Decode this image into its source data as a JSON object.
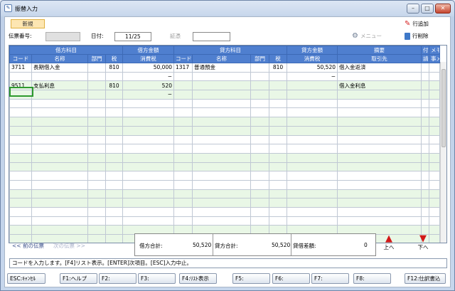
{
  "window": {
    "title": "振替入力",
    "minimize": "–",
    "maximize": "□",
    "close": "✕"
  },
  "toolbar": {
    "new_label": "新規",
    "slip_no_label": "伝票番号:",
    "slip_no_value": "",
    "date_label": "日付:",
    "date_value": "11/25",
    "summary_label": "証憑",
    "summary_value": "",
    "menu_label": "メニュー",
    "add_row_label": "行追加",
    "delete_row_label": "行削除"
  },
  "grid": {
    "group_headers": [
      "借方科目",
      "借方金額",
      "貸方科目",
      "貸方金額",
      "摘要",
      "付",
      "メモ"
    ],
    "sub_headers": [
      "コード",
      "名称",
      "部門",
      "税",
      "消費税",
      "コード",
      "名称",
      "部門",
      "税",
      "消費税",
      "取引先",
      "請",
      "事メモ"
    ],
    "rows": [
      [
        "3711",
        "長期借入金",
        "",
        "810",
        "50,000",
        "1317",
        "普通預金",
        "",
        "810",
        "50,520",
        "借入金返済",
        "",
        ""
      ],
      [
        "",
        "",
        "",
        "",
        "−",
        "",
        "",
        "",
        "",
        "−",
        "",
        "",
        ""
      ],
      [
        "9511",
        "支払利息",
        "",
        "810",
        "520",
        "",
        "",
        "",
        "",
        "",
        "借入金利息",
        "",
        ""
      ],
      [
        "",
        "",
        "",
        "",
        "−",
        "",
        "",
        "",
        "",
        "",
        "",
        "",
        ""
      ],
      [
        "",
        "",
        "",
        "",
        "",
        "",
        "",
        "",
        "",
        "",
        "",
        "",
        ""
      ],
      [
        "",
        "",
        "",
        "",
        "",
        "",
        "",
        "",
        "",
        "",
        "",
        "",
        ""
      ],
      [
        "",
        "",
        "",
        "",
        "",
        "",
        "",
        "",
        "",
        "",
        "",
        "",
        ""
      ],
      [
        "",
        "",
        "",
        "",
        "",
        "",
        "",
        "",
        "",
        "",
        "",
        "",
        ""
      ],
      [
        "",
        "",
        "",
        "",
        "",
        "",
        "",
        "",
        "",
        "",
        "",
        "",
        ""
      ],
      [
        "",
        "",
        "",
        "",
        "",
        "",
        "",
        "",
        "",
        "",
        "",
        "",
        ""
      ],
      [
        "",
        "",
        "",
        "",
        "",
        "",
        "",
        "",
        "",
        "",
        "",
        "",
        ""
      ],
      [
        "",
        "",
        "",
        "",
        "",
        "",
        "",
        "",
        "",
        "",
        "",
        "",
        ""
      ],
      [
        "",
        "",
        "",
        "",
        "",
        "",
        "",
        "",
        "",
        "",
        "",
        "",
        ""
      ],
      [
        "",
        "",
        "",
        "",
        "",
        "",
        "",
        "",
        "",
        "",
        "",
        "",
        ""
      ],
      [
        "",
        "",
        "",
        "",
        "",
        "",
        "",
        "",
        "",
        "",
        "",
        "",
        ""
      ],
      [
        "",
        "",
        "",
        "",
        "",
        "",
        "",
        "",
        "",
        "",
        "",
        "",
        ""
      ],
      [
        "",
        "",
        "",
        "",
        "",
        "",
        "",
        "",
        "",
        "",
        "",
        "",
        ""
      ],
      [
        "",
        "",
        "",
        "",
        "",
        "",
        "",
        "",
        "",
        "",
        "",
        "",
        ""
      ],
      [
        "",
        "",
        "",
        "",
        "",
        "",
        "",
        "",
        "",
        "",
        "",
        "",
        ""
      ],
      [
        "",
        "",
        "",
        "",
        "",
        "",
        "",
        "",
        "",
        "",
        "",
        "",
        ""
      ]
    ]
  },
  "nav": {
    "prev": "<< 前の伝票",
    "next": "次の伝票 >>",
    "up": "上へ",
    "down": "下へ"
  },
  "totals": {
    "debit_label": "借方合計:",
    "debit_value": "50,520",
    "credit_label": "貸方合計:",
    "credit_value": "50,520",
    "diff_label": "貸借差額:",
    "diff_value": "0"
  },
  "status": "コードを入力します。[F4]リスト表示。[ENTER]次項目。[ESC]入力中止。",
  "fkeys": [
    "ESC:ｷｬﾝｾﾙ",
    "F1:ヘルプ",
    "F2:",
    "F3:",
    "F4:ﾘｽﾄ表示",
    "F5:",
    "F6:",
    "F7:",
    "F8:",
    "F12:仕訳書込"
  ],
  "colors": {
    "header": "#4f7fcf",
    "alt_row": "#e9f7e6",
    "arrow": "#d21818",
    "new_badge": "#fde6b2"
  },
  "icons": [
    "window-app-icon",
    "menu-icon",
    "pen-icon",
    "trash-icon",
    "up-arrow-icon",
    "down-arrow-icon"
  ]
}
